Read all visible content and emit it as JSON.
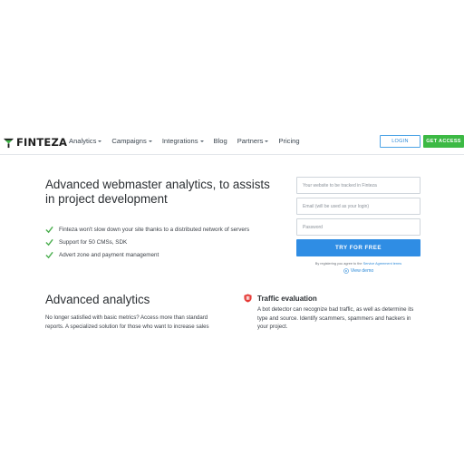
{
  "brand": {
    "name": "FINTEZA"
  },
  "nav": {
    "items": [
      {
        "label": "Analytics",
        "has_dropdown": true
      },
      {
        "label": "Campaigns",
        "has_dropdown": true
      },
      {
        "label": "Integrations",
        "has_dropdown": true
      },
      {
        "label": "Blog",
        "has_dropdown": false
      },
      {
        "label": "Partners",
        "has_dropdown": true
      },
      {
        "label": "Pricing",
        "has_dropdown": false
      }
    ],
    "login_label": "LOGIN",
    "access_label": "GET ACCESS"
  },
  "hero": {
    "title": "Advanced webmaster analytics, to assists in project development",
    "features": [
      "Finteza won't slow down your site thanks to a distributed network of servers",
      "Support for 50 CMSs, SDK",
      "Advert zone and payment management"
    ]
  },
  "signup": {
    "website_placeholder": "Your website to be tracked in Finteza",
    "email_placeholder": "Email (will be used as your login)",
    "password_placeholder": "Password",
    "submit_label": "TRY FOR FREE",
    "legal_text": "By registering you agree to the",
    "legal_link": "Service Agreement terms",
    "demo_label": "View demo"
  },
  "advanced": {
    "title": "Advanced analytics",
    "text": "No longer satisfied with basic metrics? Access more than standard reports. A specialized solution for those who want to increase sales"
  },
  "traffic": {
    "title": "Traffic evaluation",
    "text": "A bot detector can recognize bad traffic, as well as determine its type and source. Identify scammers, spammers and hackers in your project."
  },
  "colors": {
    "primary": "#2f8de4",
    "access_green": "#3cb944",
    "check_green": "#4caf50",
    "traffic_red": "#e53935"
  }
}
